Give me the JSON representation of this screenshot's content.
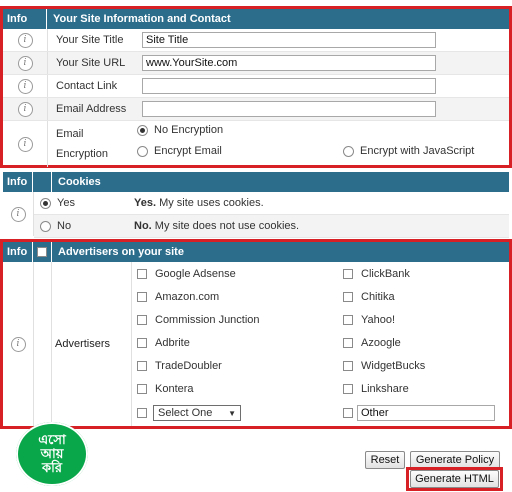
{
  "site_info": {
    "info_header": "Info",
    "title": "Your Site Information and Contact",
    "site_title_label": "Your Site Title",
    "site_title_value": "Site Title",
    "site_url_label": "Your Site URL",
    "site_url_value": "www.YourSite.com",
    "contact_link_label": "Contact Link",
    "contact_link_value": "",
    "email_address_label": "Email Address",
    "email_address_value": "",
    "email_label_line1": "Email",
    "email_label_line2": "Encryption",
    "opt_no_encryption": "No Encryption",
    "opt_encrypt_email": "Encrypt Email",
    "opt_encrypt_js": "Encrypt with JavaScript",
    "selected": "No Encryption"
  },
  "cookies": {
    "info_header": "Info",
    "title": "Cookies",
    "yes_label": "Yes",
    "yes_desc_bold": "Yes.",
    "yes_desc": " My site uses cookies.",
    "no_label": "No",
    "no_desc_bold": "No.",
    "no_desc": " My site does not use cookies.",
    "selected": "Yes"
  },
  "advertisers": {
    "info_header": "Info",
    "title": "Advertisers on your site",
    "label": "Advertisers",
    "left": [
      "Google Adsense",
      "Amazon.com",
      "Commission Junction",
      "Adbrite",
      "TradeDoubler",
      "Kontera"
    ],
    "right": [
      "ClickBank",
      "Chitika",
      "Yahoo!",
      "Azoogle",
      "WidgetBucks",
      "Linkshare"
    ],
    "select_value": "Select One",
    "other_value": "Other"
  },
  "buttons": {
    "reset": "Reset",
    "generate_policy": "Generate Policy",
    "generate_html": "Generate HTML"
  },
  "logo": {
    "line1": "এসো",
    "line2": "আয়",
    "line3": "করি"
  },
  "colors": {
    "header_bg": "#2c6d8c",
    "highlight": "#d71f26",
    "logo": "#0aa64a"
  }
}
